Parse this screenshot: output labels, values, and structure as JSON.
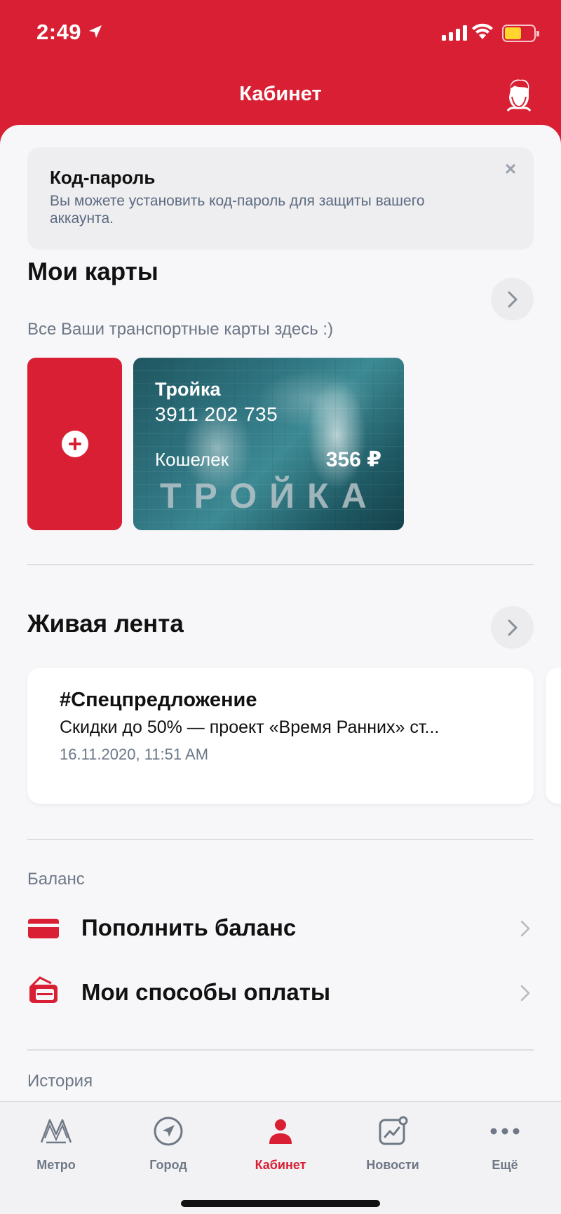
{
  "status_bar": {
    "time": "2:49"
  },
  "header": {
    "title": "Кабинет"
  },
  "passcode_banner": {
    "title": "Код-пароль",
    "text": "Вы можете установить код-пароль для защиты вашего аккаунта."
  },
  "my_cards": {
    "title": "Мои карты",
    "subtitle": "Все Ваши транспортные карты здесь :)",
    "card": {
      "name": "Тройка",
      "number": "3911 202 735",
      "wallet_label": "Кошелек",
      "balance": "356 ₽",
      "brand": "ТРОЙКА"
    }
  },
  "live_feed": {
    "title": "Живая лента",
    "item": {
      "tag": "#Спецпредложение",
      "text": "Скидки до 50% — проект «Время Ранних» ст...",
      "date": "16.11.2020, 11:51 AM"
    }
  },
  "balance_section": {
    "label": "Баланс",
    "items": [
      {
        "label": "Пополнить баланс",
        "icon": "credit-card-icon"
      },
      {
        "label": "Мои способы оплаты",
        "icon": "wallet-cards-icon"
      }
    ]
  },
  "history_section": {
    "label": "История"
  },
  "tabbar": {
    "tabs": [
      {
        "label": "Метро",
        "icon": "metro-icon"
      },
      {
        "label": "Город",
        "icon": "navigation-icon"
      },
      {
        "label": "Кабинет",
        "icon": "person-icon",
        "active": true
      },
      {
        "label": "Новости",
        "icon": "news-chart-icon"
      },
      {
        "label": "Ещё",
        "icon": "more-dots-icon"
      }
    ]
  },
  "colors": {
    "brand_red": "#d91f33",
    "muted_text": "#6c7787",
    "background": "#f7f6f8"
  }
}
